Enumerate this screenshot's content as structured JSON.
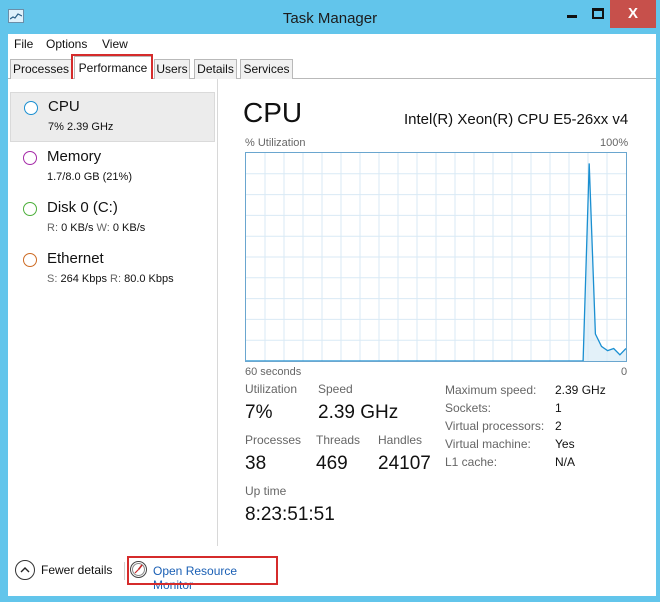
{
  "window": {
    "title": "Task Manager",
    "close_glyph": "X"
  },
  "menu": [
    "File",
    "Options",
    "View"
  ],
  "tabs": [
    {
      "label": "Processes"
    },
    {
      "label": "Performance"
    },
    {
      "label": "Users"
    },
    {
      "label": "Details"
    },
    {
      "label": "Services"
    }
  ],
  "sidebar": [
    {
      "name": "CPU",
      "detail": "7%  2.39 GHz",
      "color": "#1a8fd1",
      "selected": true
    },
    {
      "name": "Memory",
      "detail": "1.7/8.0 GB (21%)",
      "color": "#a52aa8"
    },
    {
      "name": "Disk 0 (C:)",
      "detail_parts": [
        "R:",
        "0 KB/s",
        "W:",
        "0 KB/s"
      ],
      "color": "#4caf3b"
    },
    {
      "name": "Ethernet",
      "detail_parts": [
        "S:",
        "264 Kbps",
        "R:",
        "80.0 Kbps"
      ],
      "color": "#cd6b24"
    }
  ],
  "cpu": {
    "heading": "CPU",
    "model": "Intel(R) Xeon(R) CPU E5-26xx v4",
    "graph": {
      "label": "% Utilization",
      "max_label": "100%",
      "time_label": "60 seconds",
      "zero_label": "0",
      "utilization_history": [
        0,
        0,
        0,
        0,
        0,
        0,
        0,
        0,
        0,
        0,
        0,
        0,
        0,
        0,
        0,
        0,
        0,
        0,
        0,
        0,
        0,
        0,
        0,
        0,
        0,
        0,
        0,
        0,
        0,
        0,
        0,
        0,
        0,
        0,
        0,
        0,
        0,
        0,
        0,
        0,
        0,
        0,
        0,
        0,
        0,
        0,
        0,
        0,
        0,
        0,
        0,
        0,
        0,
        0,
        0,
        0,
        95,
        13,
        7,
        5,
        6,
        3,
        6
      ]
    },
    "stats": {
      "utilization_label": "Utilization",
      "utilization": "7%",
      "speed_label": "Speed",
      "speed": "2.39 GHz",
      "processes_label": "Processes",
      "processes": "38",
      "threads_label": "Threads",
      "threads": "469",
      "handles_label": "Handles",
      "handles": "24107",
      "uptime_label": "Up time",
      "uptime": "8:23:51:51"
    },
    "details": [
      {
        "label": "Maximum speed:",
        "value": "2.39 GHz"
      },
      {
        "label": "Sockets:",
        "value": "1"
      },
      {
        "label": "Virtual processors:",
        "value": "2"
      },
      {
        "label": "Virtual machine:",
        "value": "Yes"
      },
      {
        "label": "L1 cache:",
        "value": "N/A"
      }
    ]
  },
  "footer": {
    "fewer_details": "Fewer details",
    "resource_monitor": "Open Resource Monitor"
  },
  "colors": {
    "highlight": "#d52b2b",
    "graph_line": "#1a8fd1",
    "graph_fill": "#d7ebf7",
    "link": "#1a5fb4"
  }
}
